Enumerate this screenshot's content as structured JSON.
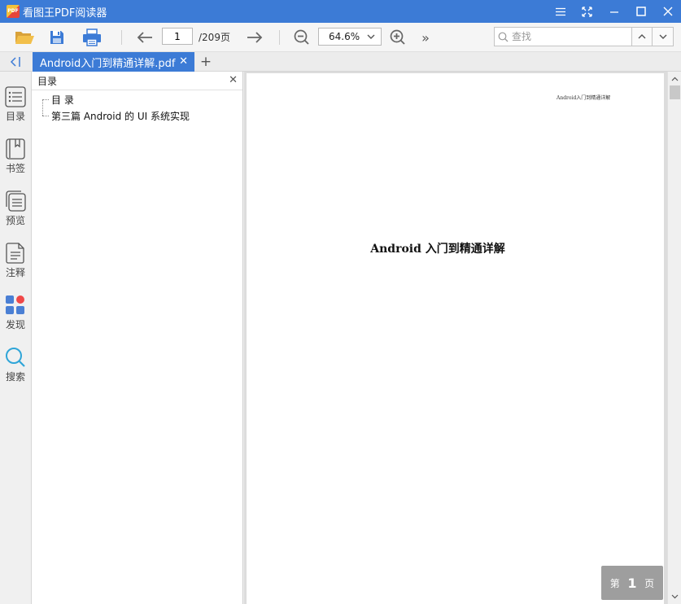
{
  "window": {
    "title": "看图王PDF阅读器",
    "app_icon_text": "PDF",
    "controls": [
      "menu",
      "fullscreen",
      "minimize",
      "maximize",
      "close"
    ]
  },
  "toolbar": {
    "current_page": "1",
    "page_total": "/209页",
    "zoom": "64.6%",
    "search_placeholder": "查找",
    "more_label": "»"
  },
  "tabs": [
    {
      "label": "Android入门到精通详解.pdf",
      "active": true
    }
  ],
  "sidebar": {
    "items": [
      {
        "label": "目录",
        "icon": "toc-icon",
        "active": true
      },
      {
        "label": "书签",
        "icon": "bookmark-icon"
      },
      {
        "label": "预览",
        "icon": "thumbnails-icon"
      },
      {
        "label": "注释",
        "icon": "annotation-icon"
      },
      {
        "label": "发现",
        "icon": "apps-icon"
      },
      {
        "label": "搜索",
        "icon": "search-icon"
      }
    ]
  },
  "toc": {
    "title": "目录",
    "items": [
      {
        "label": "目 录"
      },
      {
        "label": "第三篇 Android 的 UI 系统实现"
      }
    ]
  },
  "document": {
    "running_head": "Android入门到精通详解",
    "title": "Android 入门到精通详解"
  },
  "page_indicator": {
    "prefix": "第",
    "number": "1",
    "suffix": "页"
  },
  "colors": {
    "accent": "#3c7bd6",
    "icon_blue": "#4a7fd4",
    "icon_red": "#f04848"
  }
}
